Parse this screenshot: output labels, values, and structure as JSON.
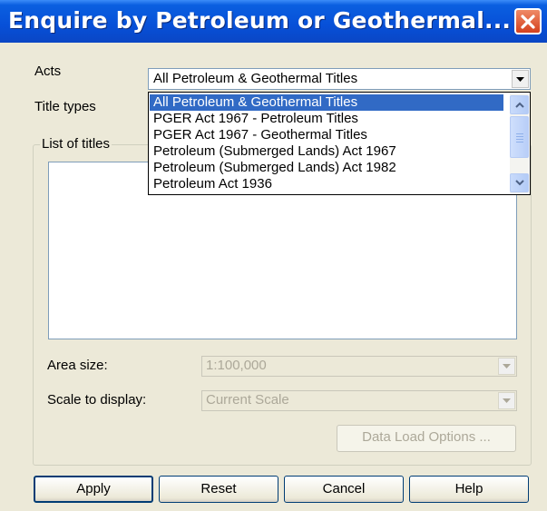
{
  "window": {
    "title": "Enquire by Petroleum or Geothermal..."
  },
  "form": {
    "acts_label": "Acts",
    "acts_value": "All Petroleum & Geothermal Titles",
    "title_types_label": "Title types",
    "list_of_titles_label": "List of titles",
    "area_size_label": "Area size:",
    "area_size_value": "1:100,000",
    "scale_label": "Scale to display:",
    "scale_value": "Current Scale",
    "data_load_label": "Data Load Options ..."
  },
  "acts_dropdown": {
    "options": [
      "All Petroleum & Geothermal Titles",
      "PGER Act 1967 - Petroleum Titles",
      "PGER Act 1967 - Geothermal Titles",
      "Petroleum (Submerged Lands) Act 1967",
      "Petroleum (Submerged Lands) Act 1982",
      "Petroleum Act 1936"
    ],
    "selected_index": 0
  },
  "buttons": {
    "apply": "Apply",
    "reset": "Reset",
    "cancel": "Cancel",
    "help": "Help"
  },
  "icons": {
    "close": "close-icon",
    "dropdown": "chevron-down-icon",
    "scroll_up": "scroll-up-icon",
    "scroll_down": "scroll-down-icon"
  },
  "colors": {
    "titlebar": "#0750d8",
    "selection": "#316ac5",
    "close_button": "#d4411e",
    "dialog_bg": "#ece9d8"
  }
}
